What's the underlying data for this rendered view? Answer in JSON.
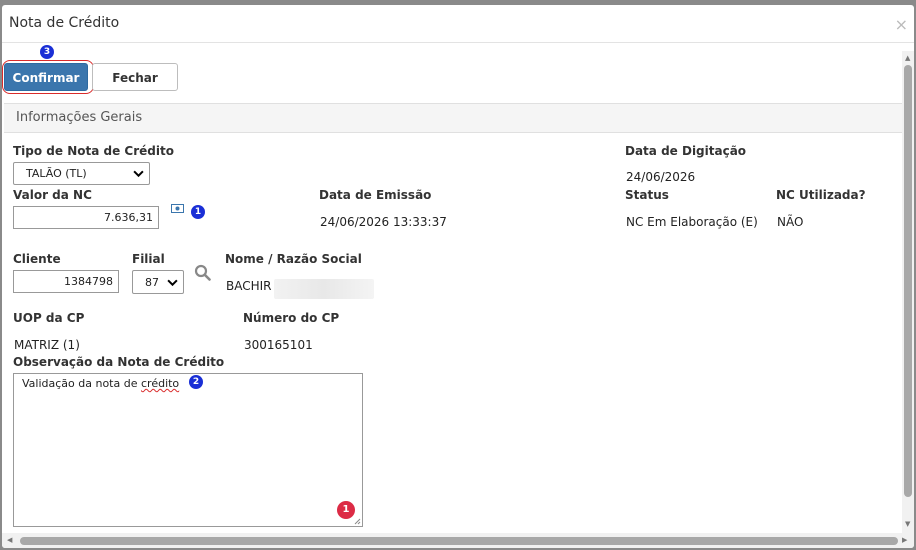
{
  "modal": {
    "title": "Nota de Crédito",
    "close_glyph": "×"
  },
  "toolbar": {
    "confirm_label": "Confirmar",
    "close_label": "Fechar"
  },
  "annotations": {
    "b1": "1",
    "b2": "2",
    "b3": "3",
    "r1": "1"
  },
  "section": {
    "title": "Informações Gerais"
  },
  "form": {
    "tipo_label": "Tipo de Nota de Crédito",
    "tipo_value": "TALÃO (TL)",
    "data_digitacao_label": "Data de Digitação",
    "data_digitacao_value": "24/06/2026",
    "valor_label": "Valor da NC",
    "valor_value": "7.636,31",
    "data_emissao_label": "Data de Emissão",
    "data_emissao_value": "24/06/2026 13:33:37",
    "status_label": "Status",
    "status_value": "NC Em Elaboração (E)",
    "nc_utilizada_label": "NC Utilizada?",
    "nc_utilizada_value": "NÃO",
    "cliente_label": "Cliente",
    "cliente_value": "1384798",
    "filial_label": "Filial",
    "filial_value": "87",
    "nome_label": "Nome / Razão Social",
    "nome_value": "BACHIR",
    "uop_label": "UOP da CP",
    "uop_value": "MATRIZ (1)",
    "numero_cp_label": "Número do CP",
    "numero_cp_value": "300165101",
    "obs_label": "Observação da Nota de Crédito",
    "obs_value_prefix": "Validação da nota de ",
    "obs_value_word": "crédito"
  },
  "icons": {
    "calc": "calculator-icon",
    "search": "search-icon",
    "close": "close-icon",
    "chevron": "chevron-down-icon"
  },
  "colors": {
    "primary": "#3b76ad",
    "badge_blue": "#1a2fd6",
    "badge_red": "#dc2b45",
    "highlight": "#d92b2b"
  }
}
